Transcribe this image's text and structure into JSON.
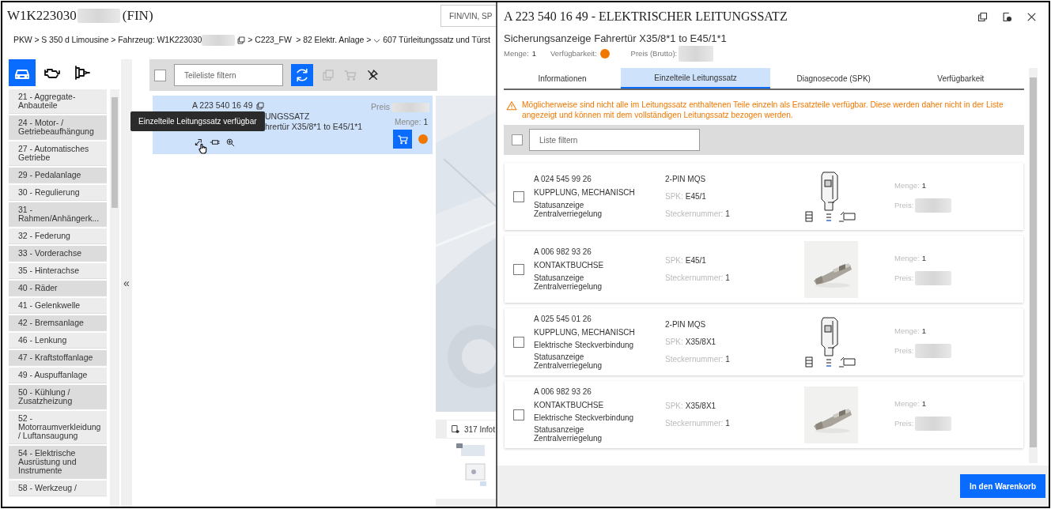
{
  "header": {
    "vin_prefix": "W1K223030",
    "vin_suffix": "(FIN)",
    "search_placeholder": "FIN/VIN, SP"
  },
  "breadcrumb": {
    "start": "PKW > S 350 d Limousine > Fahrzeug: W1K223030",
    "middle": "> C223_FW  > 82 Elektr. Anlage >",
    "last": "607 Türleitungssatz und Türst"
  },
  "view_tabs": [
    {
      "kind": "car",
      "selected": true
    },
    {
      "kind": "engine",
      "selected": false
    },
    {
      "kind": "transmission",
      "selected": false
    }
  ],
  "groups": [
    "21 - Aggregate-Anbauteile",
    "24 - Motor- / Getriebeaufhängung",
    "27 - Automatisches Getriebe",
    "29 - Pedalanlage",
    "30 - Regulierung",
    "31 - Rahmen/Anhängerk...",
    "32 - Federung",
    "33 - Vorderachse",
    "35 - Hinterachse",
    "40 - Räder",
    "41 - Gelenkwelle",
    "42 - Bremsanlage",
    "46 - Lenkung",
    "47 - Kraftstoffanlage",
    "49 - Auspuffanlage",
    "50 - Kühlung / Zusatzheizung",
    "52 - Motorraumverkleidung / Luftansaugung",
    "54 - Elektrische Ausrüstung und Instrumente",
    "58 - Werkzeug /"
  ],
  "collapse": "«",
  "parts": {
    "filter_placeholder": "Teileliste filtern",
    "checked": false,
    "item": {
      "number": "A 223 540 16 49",
      "name": "UNGSSATZ",
      "description": "hrertür X35/8*1 to E45/1*1",
      "price_label": "Preis",
      "qty_label": "Menge:",
      "qty": "1",
      "selected": true
    },
    "tooltip": "Einzelteile Leitungssatz verfügbar"
  },
  "viewer": {
    "info_tab": "317 Infot"
  },
  "drawer": {
    "title": "A 223 540 16 49 - ELEKTRISCHER LEITUNGSSATZ",
    "subtitle": "Sicherungsanzeige Fahrertür X35/8*1 to E45/1*1",
    "qty_label": "Menge:",
    "qty": "1",
    "availability_label": "Verfügbarkeit:",
    "price_label": "Preis (Brutto):",
    "tabs": [
      {
        "label": "Informationen",
        "selected": false
      },
      {
        "label": "Einzelteile Leitungssatz",
        "selected": true
      },
      {
        "label": "Diagnosecode (SPK)",
        "selected": false
      },
      {
        "label": "Verfügbarkeit",
        "selected": false
      }
    ],
    "warning": "Möglicherweise sind nicht alle im Leitungssatz enthaltenen Teile einzeln als Ersatzteile verfügbar. Diese werden daher nicht in der Liste angezeigt und können mit dem vollständigen Leitungssatz bezogen werden.",
    "filter_placeholder": "Liste filtern",
    "all_checked": false,
    "items": [
      {
        "number": "A 024 545 99 26",
        "name": "KUPPLUNG, MECHANISCH",
        "notes": [
          "Statusanzeige Zentralverriegelung"
        ],
        "type": "2-PIN MQS",
        "spk_label": "SPK:",
        "spk": "E45/1",
        "plug_label": "Steckernummer:",
        "plug": "1",
        "kind": "drawing",
        "qty_label": "Menge:",
        "qty": "1",
        "price_label": "Preis:",
        "checked": false
      },
      {
        "number": "A 006 982 93 26",
        "name": "KONTAKTBUCHSE",
        "notes": [
          "Statusanzeige Zentralverriegelung"
        ],
        "spk_label": "SPK:",
        "spk": "E45/1",
        "plug_label": "Steckernummer:",
        "plug": "1",
        "qty_label": "Menge:",
        "qty": "1",
        "price_label": "Preis:",
        "checked": false
      },
      {
        "number": "A 025 545 01 26",
        "name": "KUPPLUNG, MECHANISCH",
        "notes": [
          "Elektrische Steckverbindung",
          "Statusanzeige Zentralverriegelung"
        ],
        "type": "2-PIN MQS",
        "spk_label": "SPK:",
        "spk": "X35/8X1",
        "plug_label": "Steckernummer:",
        "plug": "1",
        "kind": "drawing",
        "qty_label": "Menge:",
        "qty": "1",
        "price_label": "Preis:",
        "checked": false
      },
      {
        "number": "A 006 982 93 26",
        "name": "KONTAKTBUCHSE",
        "notes": [
          "Elektrische Steckverbindung",
          "Statusanzeige Zentralverriegelung"
        ],
        "spk_label": "SPK:",
        "spk": "X35/8X1",
        "plug_label": "Steckernummer:",
        "plug": "1",
        "qty_label": "Menge:",
        "qty": "1",
        "price_label": "Preis:",
        "checked": false
      }
    ],
    "cart_button": "In den Warenkorb"
  }
}
